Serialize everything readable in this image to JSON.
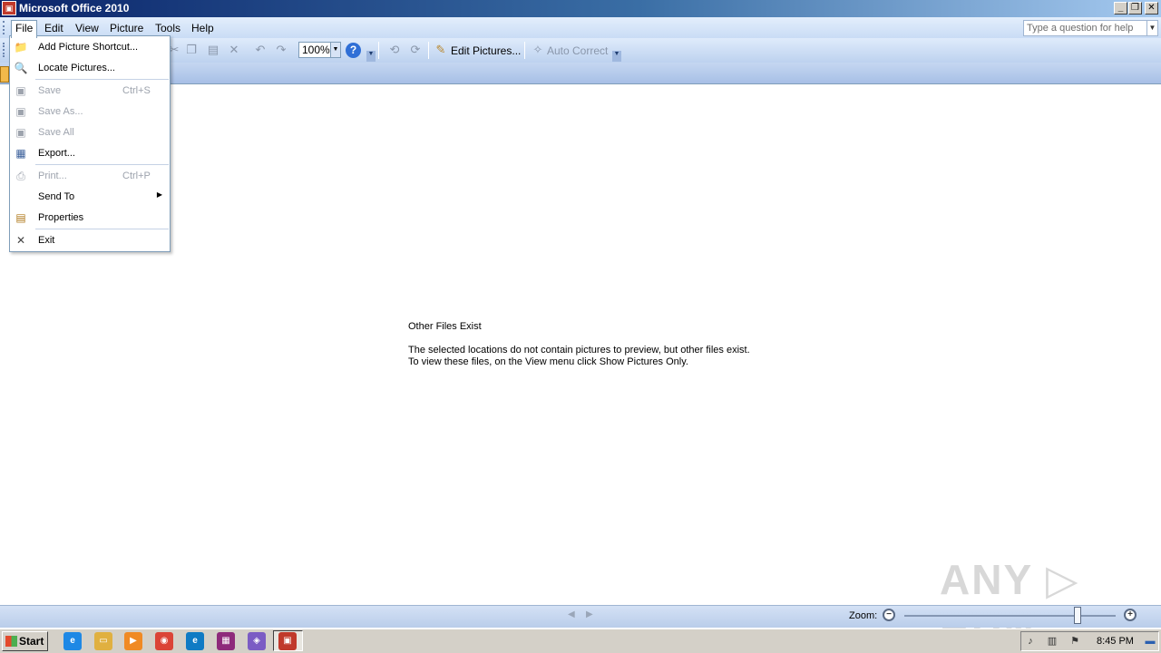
{
  "window": {
    "title": "Microsoft Office 2010",
    "app_icon": "office-picture-manager-icon"
  },
  "window_controls": {
    "minimize": "_",
    "restore": "❐",
    "close": "✕"
  },
  "menubar": {
    "items": [
      {
        "label": "File"
      },
      {
        "label": "Edit"
      },
      {
        "label": "View"
      },
      {
        "label": "Picture"
      },
      {
        "label": "Tools"
      },
      {
        "label": "Help"
      }
    ],
    "help_box_placeholder": "Type a question for help"
  },
  "toolbar": {
    "zoom_value": "100%",
    "help_glyph": "?",
    "edit_pictures_label": "Edit Pictures...",
    "auto_correct_label": "Auto Correct"
  },
  "file_menu": {
    "items": [
      {
        "label": "Add Picture Shortcut...",
        "shortcut": "",
        "disabled": false,
        "icon": "add-picture-shortcut-icon"
      },
      {
        "label": "Locate Pictures...",
        "shortcut": "",
        "disabled": false,
        "icon": "locate-pictures-icon"
      },
      {
        "label": "Save",
        "shortcut": "Ctrl+S",
        "disabled": true,
        "icon": "save-icon"
      },
      {
        "label": "Save As...",
        "shortcut": "",
        "disabled": true,
        "icon": "save-as-icon"
      },
      {
        "label": "Save All",
        "shortcut": "",
        "disabled": true,
        "icon": "save-all-icon"
      },
      {
        "label": "Export...",
        "shortcut": "",
        "disabled": false,
        "icon": "export-icon"
      },
      {
        "label": "Print...",
        "shortcut": "Ctrl+P",
        "disabled": true,
        "icon": "print-icon"
      },
      {
        "label": "Send To",
        "shortcut": "",
        "disabled": false,
        "icon": ""
      },
      {
        "label": "Properties",
        "shortcut": "",
        "disabled": false,
        "icon": "properties-icon"
      },
      {
        "label": "Exit",
        "shortcut": "",
        "disabled": false,
        "icon": "close-icon"
      }
    ]
  },
  "content": {
    "title": "Other Files Exist",
    "line1": "The selected locations do not contain pictures to preview, but other files exist.",
    "line2": "To view these files, on the View menu click Show Pictures Only."
  },
  "watermark": "ANY RUN",
  "statusbar": {
    "zoom_label": "Zoom:",
    "zoom_out": "−",
    "zoom_in": "+",
    "zoom_level_fraction": 0.82
  },
  "taskbar": {
    "start_label": "Start",
    "clock": "8:45 PM",
    "apps": [
      {
        "name": "internet-explorer-icon",
        "color": "#1e88e5",
        "glyph": "e"
      },
      {
        "name": "file-explorer-icon",
        "color": "#e0b040",
        "glyph": "▭"
      },
      {
        "name": "media-player-icon",
        "color": "#f08a24",
        "glyph": "▶"
      },
      {
        "name": "chrome-icon",
        "color": "#db4437",
        "glyph": "◉"
      },
      {
        "name": "edge-icon",
        "color": "#0f7bc4",
        "glyph": "e"
      },
      {
        "name": "winrar-icon",
        "color": "#8e2a7b",
        "glyph": "▦"
      },
      {
        "name": "visual-studio-icon",
        "color": "#7b5cc4",
        "glyph": "◈"
      },
      {
        "name": "picture-manager-icon",
        "color": "#c0392b",
        "glyph": "▣"
      }
    ]
  }
}
